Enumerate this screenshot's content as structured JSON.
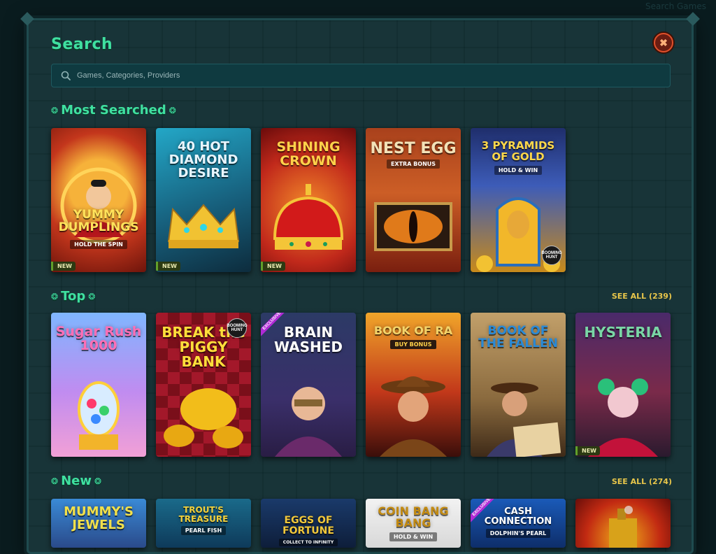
{
  "backdrop": {
    "text": "Search Games"
  },
  "modal": {
    "title": "Search",
    "close_label": "✖"
  },
  "search": {
    "placeholder": "Games, Categories, Providers",
    "value": ""
  },
  "sections": {
    "most_searched": {
      "title": "Most Searched"
    },
    "top": {
      "title": "Top",
      "see_all": "SEE ALL (239)"
    },
    "new": {
      "title": "New",
      "see_all": "SEE ALL (274)"
    }
  },
  "most_searched_games": [
    {
      "title": "YUMMY DUMPLINGS",
      "subtitle": "HOLD THE SPIN",
      "badge": "NEW"
    },
    {
      "title": "40 HOT DIAMOND DESIRE",
      "badge": "NEW"
    },
    {
      "title": "SHINING CROWN",
      "badge": "NEW"
    },
    {
      "title": "NEST EGG",
      "subtitle": "EXTRA BONUS"
    },
    {
      "title": "3 PYRAMIDS OF GOLD",
      "subtitle": "HOLD & WIN",
      "brand": "BOOMING HUNT"
    }
  ],
  "top_games": [
    {
      "title": "Sugar Rush 1000"
    },
    {
      "title": "BREAK the PIGGY BANK",
      "brand": "BOOMING HUNT"
    },
    {
      "title": "BRAIN WASHED",
      "exclusive": "EXCLUSIVE"
    },
    {
      "title": "BOOK OF RA",
      "subtitle": "BUY BONUS"
    },
    {
      "title": "BOOK OF THE FALLEN"
    },
    {
      "title": "HYSTERIA",
      "badge": "NEW"
    }
  ],
  "new_games": [
    {
      "title": "MUMMY'S JEWELS"
    },
    {
      "title": "TROUT'S TREASURE",
      "subtitle": "PEARL FISH"
    },
    {
      "title": "EGGS OF FORTUNE",
      "subtitle": "COLLECT TO INFINITY"
    },
    {
      "title": "COIN BANG BANG",
      "subtitle": "HOLD & WIN"
    },
    {
      "title": "CASH CONNECTION",
      "subtitle": "DOLPHIN'S PEARL",
      "exclusive": "EXCLUSIVE"
    },
    {
      "title": ""
    }
  ],
  "colors": {
    "accent": "#3fe0a0",
    "see_all": "#e8c64a",
    "background": "#112e32",
    "close": "#e0502b"
  },
  "icons": {
    "search": "search-icon",
    "close": "close-icon"
  }
}
